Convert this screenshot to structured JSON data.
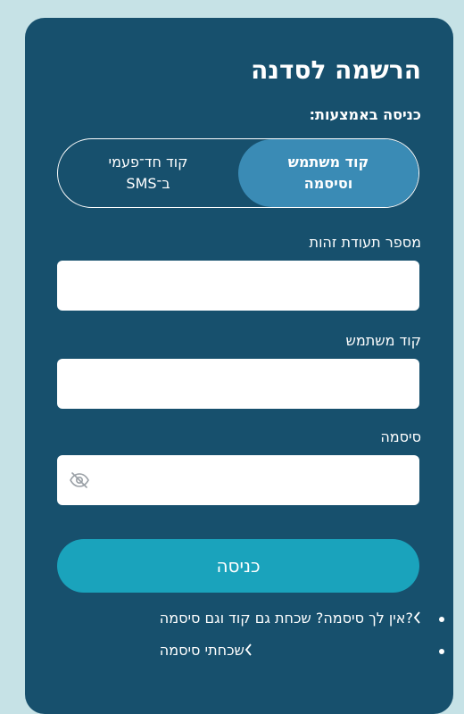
{
  "header": {
    "title": "הרשמה לסדנה"
  },
  "login_method": {
    "label": "כניסה באמצעות:",
    "options": [
      {
        "label": "קוד משתמש\nוסיסמה",
        "active": true
      },
      {
        "label": "קוד חד־פעמי\nב־SMS",
        "active": false
      }
    ]
  },
  "fields": {
    "id_number": {
      "label": "מספר תעודת זהות",
      "value": "",
      "placeholder": ""
    },
    "user_code": {
      "label": "קוד משתמש",
      "value": "",
      "placeholder": ""
    },
    "password": {
      "label": "סיסמה",
      "value": "",
      "placeholder": ""
    }
  },
  "password_toggle_icon": "eye-off-icon",
  "submit_label": "כניסה",
  "links": [
    {
      "label": "אין לך סיסמה? שכחת גם קוד וגם סיסמה?"
    },
    {
      "label": "שכחתי סיסמה"
    }
  ],
  "colors": {
    "background": "#c6e2e6",
    "card": "#17506d",
    "active_toggle": "#3a8bb5",
    "submit": "#1aa3bc",
    "text": "#ffffff"
  }
}
